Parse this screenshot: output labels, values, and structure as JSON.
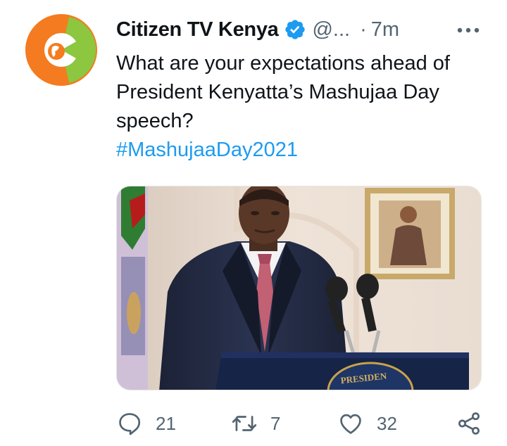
{
  "tweet": {
    "author_name": "Citizen TV Kenya",
    "handle": "@...",
    "separator": "·",
    "time": "7m",
    "text_lines": [
      "What are your expectations ahead of",
      "President Kenyatta’s Mashujaa Day",
      "speech?"
    ],
    "hashtag": "#MashujaaDay2021",
    "podium_text": "PRESIDEN"
  },
  "actions": {
    "replies": "21",
    "retweets": "7",
    "likes": "32"
  },
  "colors": {
    "avatar_orange": "#f47b20",
    "avatar_green": "#8dc63f",
    "verified_blue": "#1d9bf0",
    "hashtag_blue": "#1d9bf0",
    "muted_text": "#536471"
  },
  "icons": [
    "citizen-tv-logo-icon",
    "verified-badge-icon",
    "more-options-icon",
    "reply-icon",
    "retweet-icon",
    "like-icon",
    "share-icon"
  ]
}
